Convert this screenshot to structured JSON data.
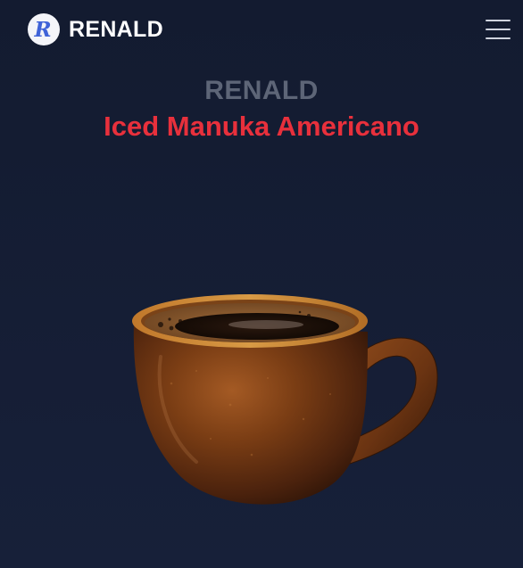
{
  "header": {
    "logo_letter": "R",
    "brand_name": "RENALD",
    "menu_icon": "hamburger-menu-icon"
  },
  "hero": {
    "brand_heading": "RENALD",
    "product_title": "Iced Manuka Americano"
  },
  "product_image": {
    "subject": "coffee-cup",
    "colors": {
      "cup": "#7a3d14",
      "coffee": "#1b1009",
      "crema": "#8a5a2b"
    }
  },
  "colors": {
    "background": "#141c31",
    "title_red": "#e8303c",
    "brand_gray": "#5d6577",
    "logo_blue": "#3f63d8"
  }
}
